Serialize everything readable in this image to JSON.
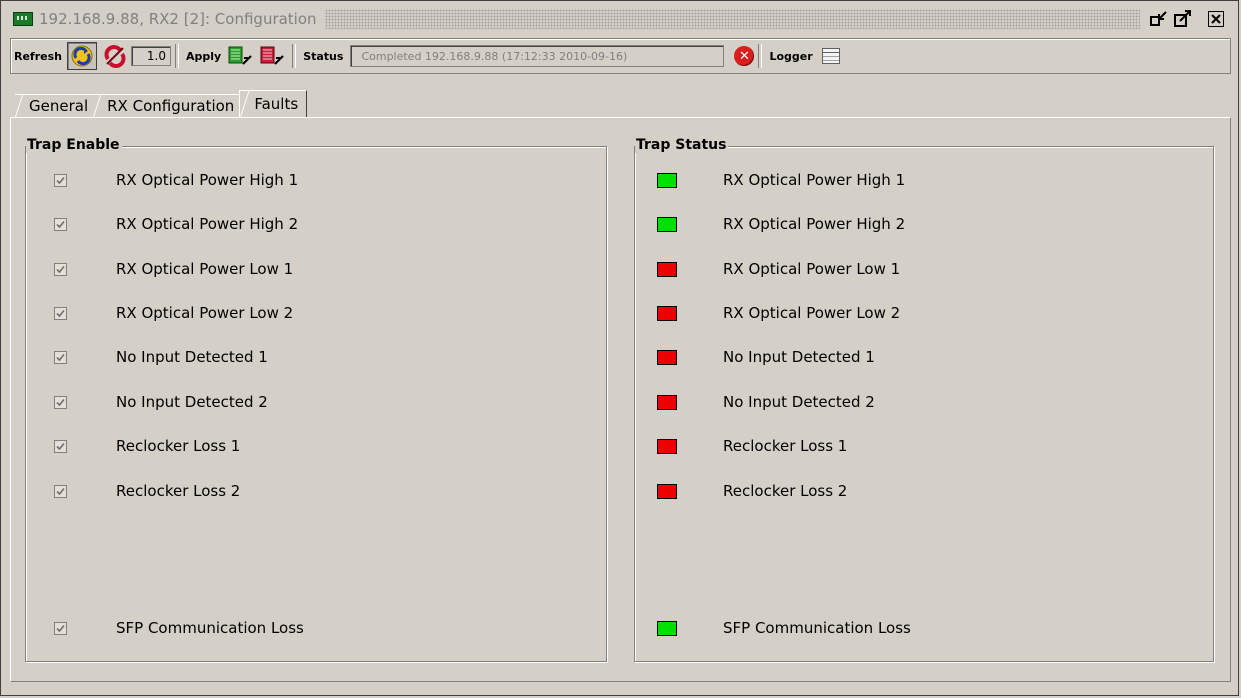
{
  "window": {
    "title": "192.168.9.88, RX2  [2]: Configuration",
    "icon": "device-board-icon"
  },
  "toolbar": {
    "refresh_label": "Refresh",
    "interval_value": "1.0",
    "apply_label": "Apply",
    "status_label": "Status",
    "status_text": "Completed 192.168.9.88 (17:12:33  2010-09-16)",
    "logger_label": "Logger"
  },
  "tabs": [
    {
      "label": "General",
      "active": false
    },
    {
      "label": "RX Configuration",
      "active": false
    },
    {
      "label": "Faults",
      "active": true
    }
  ],
  "trap_enable": {
    "title": "Trap Enable",
    "items": [
      {
        "label": "RX Optical Power High 1",
        "checked": true
      },
      {
        "label": "RX Optical Power High 2",
        "checked": true
      },
      {
        "label": "RX Optical Power Low 1",
        "checked": true
      },
      {
        "label": "RX Optical Power Low 2",
        "checked": true
      },
      {
        "label": "No Input Detected 1",
        "checked": true
      },
      {
        "label": "No Input Detected 2",
        "checked": true
      },
      {
        "label": "Reclocker Loss 1",
        "checked": true
      },
      {
        "label": "Reclocker Loss 2",
        "checked": true
      },
      {
        "label": "SFP Communication Loss",
        "checked": true
      }
    ]
  },
  "trap_status": {
    "title": "Trap Status",
    "items": [
      {
        "label": "RX Optical Power High 1",
        "status": "ok",
        "color": "#00e000"
      },
      {
        "label": "RX Optical Power High 2",
        "status": "ok",
        "color": "#00e000"
      },
      {
        "label": "RX Optical Power Low 1",
        "status": "fault",
        "color": "#ee0000"
      },
      {
        "label": "RX Optical Power Low 2",
        "status": "fault",
        "color": "#ee0000"
      },
      {
        "label": "No Input Detected 1",
        "status": "fault",
        "color": "#ee0000"
      },
      {
        "label": "No Input Detected 2",
        "status": "fault",
        "color": "#ee0000"
      },
      {
        "label": "Reclocker Loss 1",
        "status": "fault",
        "color": "#ee0000"
      },
      {
        "label": "Reclocker Loss 2",
        "status": "fault",
        "color": "#ee0000"
      },
      {
        "label": "SFP Communication Loss",
        "status": "ok",
        "color": "#00e000"
      }
    ]
  }
}
